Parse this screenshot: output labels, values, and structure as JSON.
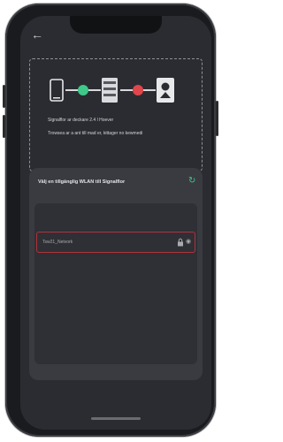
{
  "nav": {
    "back_icon": "arrow-left-icon"
  },
  "diagram": {
    "icons": [
      "phone-icon",
      "success-dot-icon",
      "router-icon",
      "error-dot-icon",
      "solar-inverter-icon"
    ],
    "status_colors": {
      "ok": "#3ec98a",
      "error": "#e0464c"
    },
    "line1": "Signalflor ar deckare 2.4 l Hoever",
    "line2": "Trowsea ar a ant till mad er, kittager no kewmedi"
  },
  "wifi_section": {
    "title": "Välj en tillgänglig WLAN till Signalflor",
    "refresh_icon": "refresh-icon",
    "networks": [
      {
        "ssid": "Tsw21_Netvork",
        "lock_icon": "lock-icon",
        "signal_icon": "wifi-signal-icon",
        "selected": true
      }
    ]
  },
  "colors": {
    "accent": "#3ec98a",
    "selection": "#b0323a",
    "background": "#2b2c31"
  }
}
